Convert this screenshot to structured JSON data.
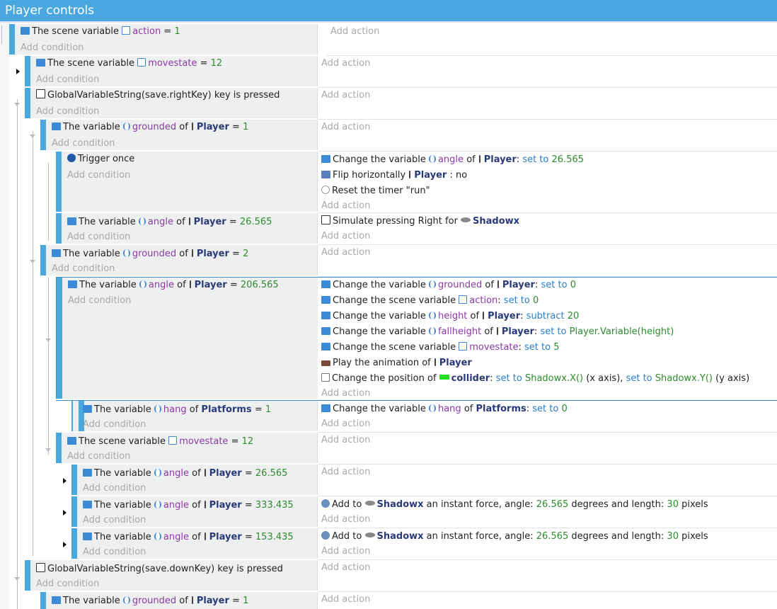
{
  "header": {
    "title": "Player controls"
  },
  "labels": {
    "add_condition": "Add condition",
    "add_action": "Add action",
    "scene_var": "The scene variable",
    "the_variable": "The variable",
    "of": "of",
    "eq": "=",
    "change_var": "Change the variable",
    "change_scene_var": "Change the scene variable",
    "set_to": "set to",
    "subtract": "subtract",
    "key_pressed": "key is pressed",
    "trigger_once": "Trigger once",
    "flip": "Flip horizontally",
    "no": ": no",
    "reset_timer": "Reset the timer \"run\"",
    "simulate_right": "Simulate pressing Right for",
    "play_anim": "Play the animation of",
    "change_pos": "Change the position of",
    "x_axis": "(x axis),",
    "y_axis": "(y axis)",
    "add_to": "Add to",
    "force_mid": "an instant force, angle:",
    "degrees_len": "degrees and length:",
    "pixels": "pixels"
  },
  "names": {
    "action": "action",
    "movestate": "movestate",
    "grounded": "grounded",
    "angle": "angle",
    "height": "height",
    "fallheight": "fallheight",
    "hang": "hang",
    "player": "Player",
    "platforms": "Platforms",
    "shadowx": "Shadowx",
    "collider": "collider",
    "right_key": "GlobalVariableString(save.rightKey)",
    "down_key": "GlobalVariableString(save.downKey)",
    "player_var_height": "Player.Variable(height)",
    "shadowx_x": "Shadowx.X()",
    "shadowx_y": "Shadowx.Y()"
  },
  "values": {
    "one": "1",
    "two": "2",
    "zero": "0",
    "five": "5",
    "twelve": "12",
    "twenty": "20",
    "thirty": "30",
    "a26": "26.565",
    "a206": "206.565",
    "a333": "333.435",
    "a153": "153.435",
    "colon": ":"
  }
}
